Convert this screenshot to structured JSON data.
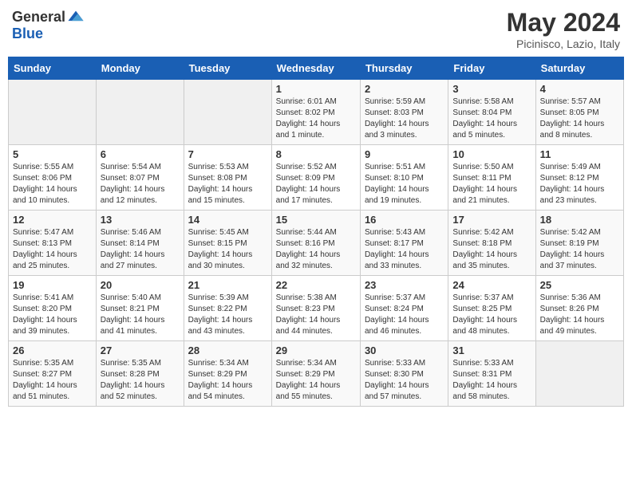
{
  "header": {
    "logo_general": "General",
    "logo_blue": "Blue",
    "title": "May 2024",
    "location": "Picinisco, Lazio, Italy"
  },
  "days_of_week": [
    "Sunday",
    "Monday",
    "Tuesday",
    "Wednesday",
    "Thursday",
    "Friday",
    "Saturday"
  ],
  "weeks": [
    [
      {
        "day": "",
        "info": ""
      },
      {
        "day": "",
        "info": ""
      },
      {
        "day": "",
        "info": ""
      },
      {
        "day": "1",
        "info": "Sunrise: 6:01 AM\nSunset: 8:02 PM\nDaylight: 14 hours\nand 1 minute."
      },
      {
        "day": "2",
        "info": "Sunrise: 5:59 AM\nSunset: 8:03 PM\nDaylight: 14 hours\nand 3 minutes."
      },
      {
        "day": "3",
        "info": "Sunrise: 5:58 AM\nSunset: 8:04 PM\nDaylight: 14 hours\nand 5 minutes."
      },
      {
        "day": "4",
        "info": "Sunrise: 5:57 AM\nSunset: 8:05 PM\nDaylight: 14 hours\nand 8 minutes."
      }
    ],
    [
      {
        "day": "5",
        "info": "Sunrise: 5:55 AM\nSunset: 8:06 PM\nDaylight: 14 hours\nand 10 minutes."
      },
      {
        "day": "6",
        "info": "Sunrise: 5:54 AM\nSunset: 8:07 PM\nDaylight: 14 hours\nand 12 minutes."
      },
      {
        "day": "7",
        "info": "Sunrise: 5:53 AM\nSunset: 8:08 PM\nDaylight: 14 hours\nand 15 minutes."
      },
      {
        "day": "8",
        "info": "Sunrise: 5:52 AM\nSunset: 8:09 PM\nDaylight: 14 hours\nand 17 minutes."
      },
      {
        "day": "9",
        "info": "Sunrise: 5:51 AM\nSunset: 8:10 PM\nDaylight: 14 hours\nand 19 minutes."
      },
      {
        "day": "10",
        "info": "Sunrise: 5:50 AM\nSunset: 8:11 PM\nDaylight: 14 hours\nand 21 minutes."
      },
      {
        "day": "11",
        "info": "Sunrise: 5:49 AM\nSunset: 8:12 PM\nDaylight: 14 hours\nand 23 minutes."
      }
    ],
    [
      {
        "day": "12",
        "info": "Sunrise: 5:47 AM\nSunset: 8:13 PM\nDaylight: 14 hours\nand 25 minutes."
      },
      {
        "day": "13",
        "info": "Sunrise: 5:46 AM\nSunset: 8:14 PM\nDaylight: 14 hours\nand 27 minutes."
      },
      {
        "day": "14",
        "info": "Sunrise: 5:45 AM\nSunset: 8:15 PM\nDaylight: 14 hours\nand 30 minutes."
      },
      {
        "day": "15",
        "info": "Sunrise: 5:44 AM\nSunset: 8:16 PM\nDaylight: 14 hours\nand 32 minutes."
      },
      {
        "day": "16",
        "info": "Sunrise: 5:43 AM\nSunset: 8:17 PM\nDaylight: 14 hours\nand 33 minutes."
      },
      {
        "day": "17",
        "info": "Sunrise: 5:42 AM\nSunset: 8:18 PM\nDaylight: 14 hours\nand 35 minutes."
      },
      {
        "day": "18",
        "info": "Sunrise: 5:42 AM\nSunset: 8:19 PM\nDaylight: 14 hours\nand 37 minutes."
      }
    ],
    [
      {
        "day": "19",
        "info": "Sunrise: 5:41 AM\nSunset: 8:20 PM\nDaylight: 14 hours\nand 39 minutes."
      },
      {
        "day": "20",
        "info": "Sunrise: 5:40 AM\nSunset: 8:21 PM\nDaylight: 14 hours\nand 41 minutes."
      },
      {
        "day": "21",
        "info": "Sunrise: 5:39 AM\nSunset: 8:22 PM\nDaylight: 14 hours\nand 43 minutes."
      },
      {
        "day": "22",
        "info": "Sunrise: 5:38 AM\nSunset: 8:23 PM\nDaylight: 14 hours\nand 44 minutes."
      },
      {
        "day": "23",
        "info": "Sunrise: 5:37 AM\nSunset: 8:24 PM\nDaylight: 14 hours\nand 46 minutes."
      },
      {
        "day": "24",
        "info": "Sunrise: 5:37 AM\nSunset: 8:25 PM\nDaylight: 14 hours\nand 48 minutes."
      },
      {
        "day": "25",
        "info": "Sunrise: 5:36 AM\nSunset: 8:26 PM\nDaylight: 14 hours\nand 49 minutes."
      }
    ],
    [
      {
        "day": "26",
        "info": "Sunrise: 5:35 AM\nSunset: 8:27 PM\nDaylight: 14 hours\nand 51 minutes."
      },
      {
        "day": "27",
        "info": "Sunrise: 5:35 AM\nSunset: 8:28 PM\nDaylight: 14 hours\nand 52 minutes."
      },
      {
        "day": "28",
        "info": "Sunrise: 5:34 AM\nSunset: 8:29 PM\nDaylight: 14 hours\nand 54 minutes."
      },
      {
        "day": "29",
        "info": "Sunrise: 5:34 AM\nSunset: 8:29 PM\nDaylight: 14 hours\nand 55 minutes."
      },
      {
        "day": "30",
        "info": "Sunrise: 5:33 AM\nSunset: 8:30 PM\nDaylight: 14 hours\nand 57 minutes."
      },
      {
        "day": "31",
        "info": "Sunrise: 5:33 AM\nSunset: 8:31 PM\nDaylight: 14 hours\nand 58 minutes."
      },
      {
        "day": "",
        "info": ""
      }
    ]
  ]
}
